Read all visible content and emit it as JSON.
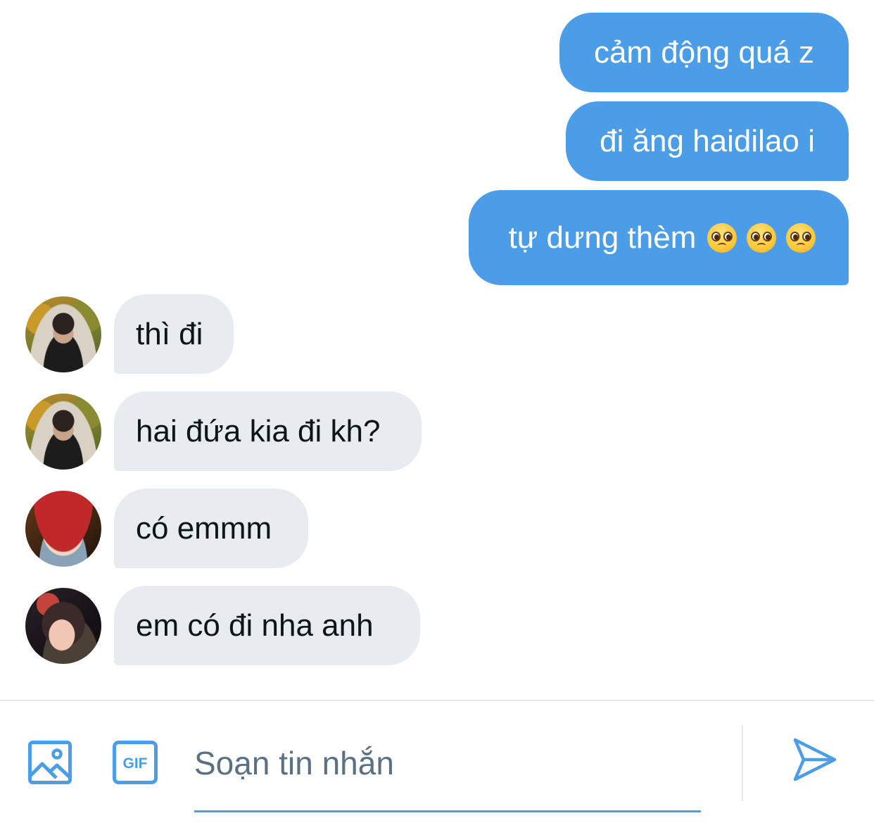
{
  "messages": {
    "outgoing": [
      {
        "text": "cảm động quá z"
      },
      {
        "text": "đi ăng haidilao i"
      },
      {
        "text": "tự dưng thèm",
        "emoji": [
          "🥺",
          "🥺",
          "🥺"
        ]
      }
    ],
    "incoming": [
      {
        "text": "thì đi",
        "avatar": "avatar-user-a"
      },
      {
        "text": "hai đứa kia đi kh?",
        "avatar": "avatar-user-a"
      },
      {
        "text": "có emmm",
        "avatar": "avatar-user-b"
      },
      {
        "text": "em có đi nha anh",
        "avatar": "avatar-user-c"
      }
    ]
  },
  "composer": {
    "placeholder": "Soạn tin nhắn",
    "value": "",
    "gif_label": "GIF",
    "icons": [
      "image-icon",
      "gif-icon",
      "send-icon"
    ]
  },
  "colors": {
    "outgoing_bubble": "#4c9de8",
    "incoming_bubble": "#e8ebef",
    "accent": "#4c9de8",
    "placeholder_text": "#5b7083"
  }
}
